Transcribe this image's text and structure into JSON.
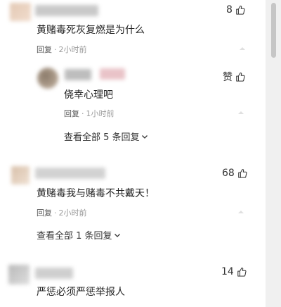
{
  "comments": [
    {
      "likes": "8",
      "text": "黄赌毒死灰复燃是为什么",
      "reply_label": "回复",
      "time": "2小时前",
      "reply": {
        "likes": "赞",
        "text": "侥幸心理吧",
        "reply_label": "回复",
        "time": "1小时前"
      },
      "view_all": "查看全部 5 条回复"
    },
    {
      "likes": "68",
      "text": "黄赌毒我与赌毒不共戴天！",
      "reply_label": "回复",
      "time": "2小时前",
      "view_all": "查看全部 1 条回复"
    },
    {
      "likes": "14",
      "text": "严惩必须严惩举报人"
    }
  ],
  "colors": {
    "text": "#222222",
    "meta": "#999999",
    "scrollbar": "#c6c6c6"
  },
  "icons": {
    "like": "thumbs-up-icon",
    "expand": "chevron-down-icon"
  }
}
